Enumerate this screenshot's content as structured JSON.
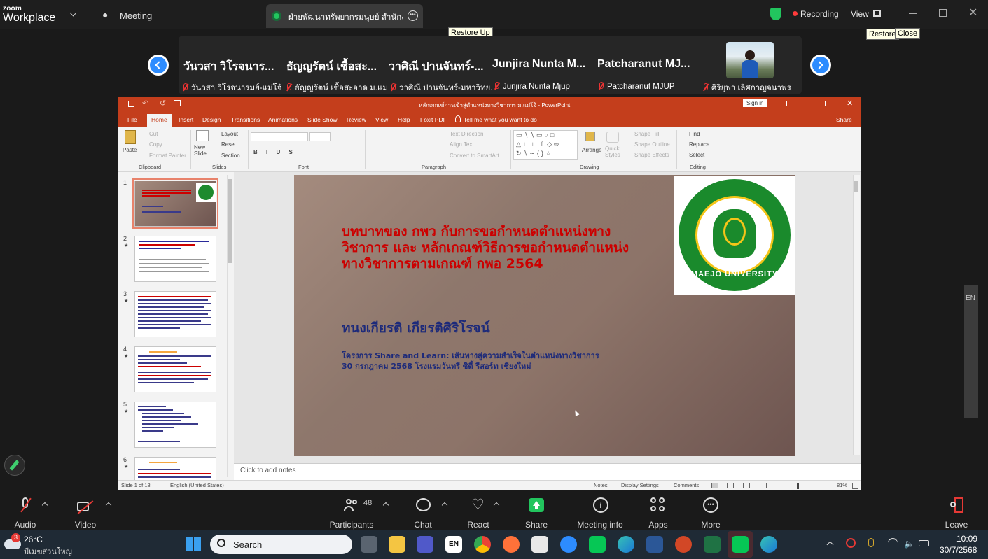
{
  "zoom": {
    "logo_line1": "zoom",
    "logo_line2": "Workplace",
    "meeting_label": "Meeting",
    "share_tab_title": "ฝ่ายพัฒนาทรัพยากรมนุษย์ สำนักงานม",
    "recording_label": "Recording",
    "view_label": "View",
    "tooltip_restore_up": "Restore Up",
    "tooltip_restore": "Restore",
    "tooltip_close": "Close",
    "side_label": "EN"
  },
  "participants": [
    {
      "name": "วันวสา วิโรจนาร...",
      "sub": "วันวสา วิโรจนารมย์-แม่โจ้..."
    },
    {
      "name": "ธัญญรัตน์ เชื้อสะ...",
      "sub": "ธัญญรัตน์ เชื้อสะอาด ม.แม่..."
    },
    {
      "name": "วาศิณี ปานจันทร์-...",
      "sub": "วาศิณี ปานจันทร์-มหาวิทย..."
    },
    {
      "name": "Junjira Nunta M...",
      "sub": "Junjira Nunta Mjup"
    },
    {
      "name": "Patcharanut MJ...",
      "sub": "Patcharanut MJUP"
    },
    {
      "name": "",
      "sub": "ศิริยุพา เลิศกาญจนาพร"
    }
  ],
  "ppt": {
    "title": "หลักเกณฑ์การเข้าสู่ตำแหน่งทางวิชาการ ม.แม่โจ้  -  PowerPoint",
    "signin": "Sign in",
    "tabs": [
      "File",
      "Home",
      "Insert",
      "Design",
      "Transitions",
      "Animations",
      "Slide Show",
      "Review",
      "View",
      "Help",
      "Foxit PDF"
    ],
    "tell_me": "Tell me what you want to do",
    "share": "Share",
    "ribbon": {
      "paste": "Paste",
      "cut": "Cut",
      "copy": "Copy",
      "format_painter": "Format Painter",
      "clipboard": "Clipboard",
      "new_slide": "New Slide",
      "layout": "Layout",
      "reset": "Reset",
      "section": "Section",
      "slides": "Slides",
      "font": "Font",
      "text_direction": "Text Direction",
      "align_text": "Align Text",
      "convert_smartart": "Convert to SmartArt",
      "paragraph": "Paragraph",
      "arrange": "Arrange",
      "quick_styles": "Quick Styles",
      "shape_fill": "Shape Fill",
      "shape_outline": "Shape Outline",
      "shape_effects": "Shape Effects",
      "drawing": "Drawing",
      "find": "Find",
      "replace": "Replace",
      "select": "Select",
      "editing": "Editing"
    },
    "slide_numbers": [
      "1",
      "2",
      "3",
      "4",
      "5",
      "6"
    ],
    "slide": {
      "title": "บทบาทของ กพว กับการขอกำหนดตำแหน่งทางวิชาการ และ หลักเกณฑ์วิธีการขอกำหนดตำแหน่งทางวิชาการตามเกณฑ์ กพอ 2564",
      "presenter": "ทนงเกียรติ เกียรติศิริโรจน์",
      "project_line1": "โครงการ Share and Learn: เส้นทางสู่ความสำเร็จในตำแหน่งทางวิชาการ",
      "project_line2": "30 กรกฎาคม 2568 โรงแรมวันทรี ซิตี้ รีสอร์ท เชียงใหม่",
      "logo_text": "MAEJO UNIVERSITY"
    },
    "notes_placeholder": "Click to add notes",
    "status": {
      "slide_of": "Slide 1 of 18",
      "language": "English (United States)",
      "notes": "Notes",
      "display_settings": "Display Settings",
      "comments": "Comments",
      "zoom": "81%"
    }
  },
  "toolbar": {
    "audio": "Audio",
    "video": "Video",
    "participants": "Participants",
    "participants_count": "48",
    "chat": "Chat",
    "react": "React",
    "share": "Share",
    "meeting_info": "Meeting info",
    "apps": "Apps",
    "more": "More",
    "leave": "Leave"
  },
  "taskbar": {
    "weather_temp": "26°C",
    "weather_desc": "มีเมฆส่วนใหญ่",
    "weather_badge": "3",
    "search": "Search",
    "time": "10:09",
    "date": "30/7/2568"
  },
  "colors": {
    "zoom_blue": "#2d8cff",
    "ppt_orange": "#c43e1c",
    "share_green": "#22c55e",
    "slide_title_red": "#cc0000",
    "slide_text_navy": "#1d2a7a"
  }
}
